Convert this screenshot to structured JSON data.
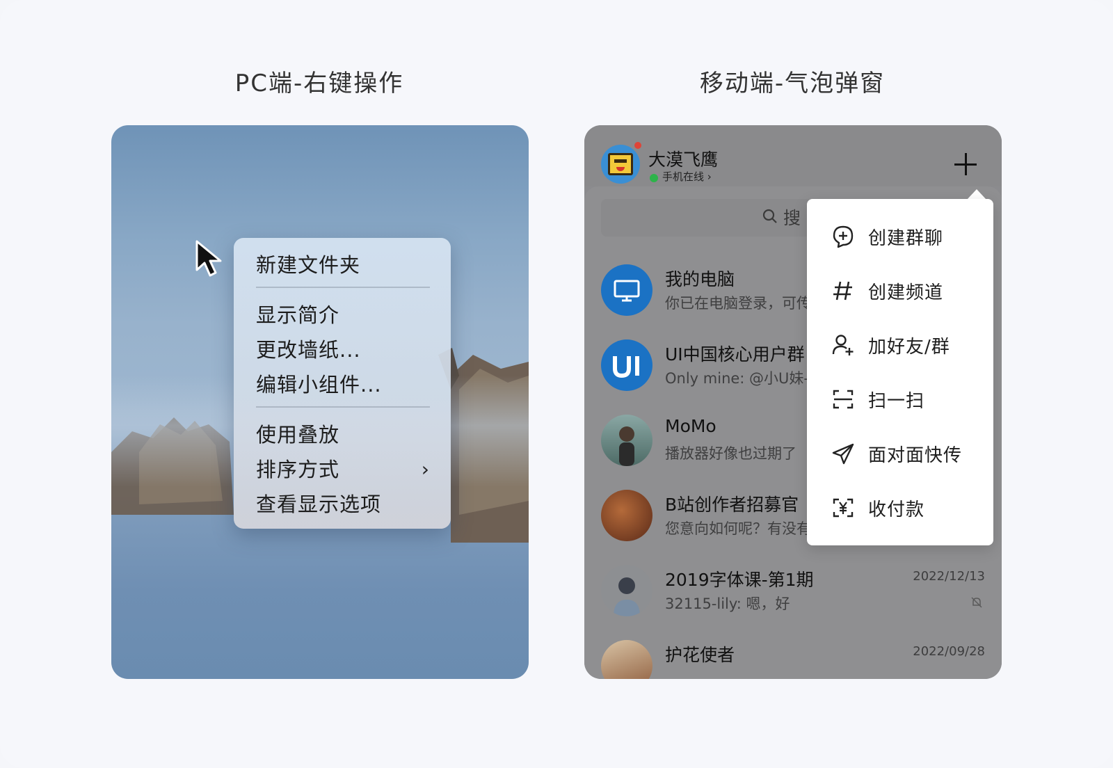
{
  "headings": {
    "pc": "PC端-右键操作",
    "mobile": "移动端-气泡弹窗"
  },
  "pc_context_menu": {
    "groups": [
      [
        "新建文件夹"
      ],
      [
        "显示简介",
        "更改墙纸...",
        "编辑小组件..."
      ],
      [
        "使用叠放",
        "排序方式",
        "查看显示选项"
      ]
    ],
    "submenu_item": "排序方式",
    "submenu_icon": "chevron-right-icon"
  },
  "mobile": {
    "user": {
      "name": "大漠飞鹰",
      "status": "手机在线 ›",
      "status_color": "#2db34a",
      "badge_color": "#e04437"
    },
    "search_placeholder": "搜",
    "conversations": [
      {
        "title": "我的电脑",
        "subtitle": "你已在电脑登录，可传",
        "date": "",
        "avatar": "monitor-icon"
      },
      {
        "title": "UI中国核心用户群",
        "subtitle": "Only mine: @小U妹-",
        "date": "",
        "avatar": "ui-logo"
      },
      {
        "title": "MoMo",
        "subtitle": "播放器好像也过期了",
        "date": "",
        "avatar": "photo-avatar"
      },
      {
        "title": "B站创作者招募官",
        "subtitle": "您意向如何呢？有没有",
        "date": "",
        "avatar": "cat-avatar"
      },
      {
        "title": "2019字体课-第1期",
        "subtitle": "32115-lily: 嗯，好",
        "date": "2022/12/13",
        "avatar": "person-avatar",
        "muted": true
      },
      {
        "title": "护花使者",
        "subtitle": "",
        "date": "2022/09/28",
        "avatar": "anime-avatar"
      }
    ],
    "bubble_menu": [
      {
        "label": "创建群聊",
        "icon": "chat-plus-icon"
      },
      {
        "label": "创建频道",
        "icon": "hashtag-icon"
      },
      {
        "label": "加好友/群",
        "icon": "add-user-icon"
      },
      {
        "label": "扫一扫",
        "icon": "scan-icon"
      },
      {
        "label": "面对面快传",
        "icon": "send-icon"
      },
      {
        "label": "收付款",
        "icon": "payment-icon"
      }
    ]
  }
}
